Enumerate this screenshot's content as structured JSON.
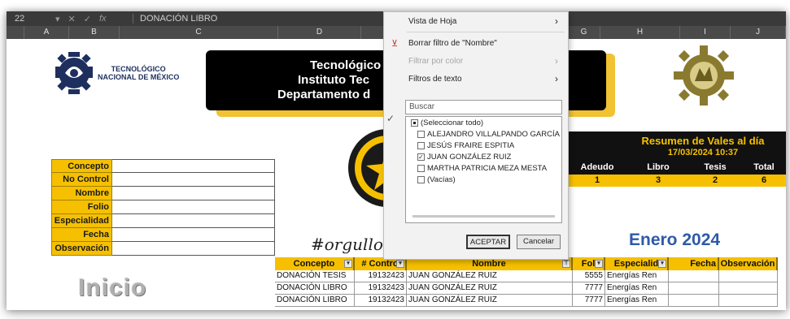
{
  "formula_bar": {
    "name_box": "22",
    "formula": "DONACIÓN LIBRO",
    "fx": "fx"
  },
  "columns": [
    "A",
    "B",
    "C",
    "D",
    "E",
    "F",
    "G",
    "H",
    "I",
    "J"
  ],
  "logo_tecnm": {
    "line1": "TECNOLÓGICO",
    "line2": "NACIONAL DE MÉXICO"
  },
  "banner": {
    "line1": "Tecnológico",
    "line2": "Instituto Tec",
    "line3": "Departamento d"
  },
  "form_labels": [
    "Concepto",
    "No Control",
    "Nombre",
    "Folio",
    "Especialidad",
    "Fecha",
    "Observación"
  ],
  "inicio": "Inicio",
  "orgullo": "#orgullo",
  "resumen": {
    "title": "Resumen de Vales al día",
    "date": "17/03/2024 10:37",
    "headers": [
      "Adeudo",
      "Libro",
      "Tesis",
      "Total"
    ],
    "values": [
      "1",
      "3",
      "2",
      "6"
    ]
  },
  "month_title": "Enero 2024",
  "table": {
    "headers": [
      "Concepto",
      "# Contro",
      "Nombre",
      "Fol",
      "Especialid",
      "Fecha",
      "Observación"
    ],
    "rows": [
      [
        "DONACIÓN TESIS",
        "19132423",
        "JUAN GONZÁLEZ RUIZ",
        "5555",
        "Energías Ren",
        "",
        ""
      ],
      [
        "DONACIÓN LIBRO",
        "19132423",
        "JUAN GONZÁLEZ RUIZ",
        "7777",
        "Energías Ren",
        "",
        ""
      ],
      [
        "DONACIÓN LIBRO",
        "19132423",
        "JUAN GONZÁLEZ RUIZ",
        "7777",
        "Energías Ren",
        "",
        ""
      ]
    ]
  },
  "filter_menu": {
    "vista_hoja": "Vista de Hoja",
    "borrar": "Borrar filtro de \"Nombre\"",
    "filtrar_color": "Filtrar por color",
    "filtros_texto": "Filtros de texto",
    "search_placeholder": "Buscar",
    "items": [
      {
        "label": "(Seleccionar todo)",
        "state": "partial"
      },
      {
        "label": "ALEJANDRO VILLALPANDO GARCÍA",
        "state": "unchecked"
      },
      {
        "label": "JESÚS FRAIRE ESPITIA",
        "state": "unchecked"
      },
      {
        "label": "JUAN GONZÁLEZ RUIZ",
        "state": "checked"
      },
      {
        "label": "MARTHA PATRICIA MEZA MESTA",
        "state": "unchecked"
      },
      {
        "label": "(Vacías)",
        "state": "unchecked"
      }
    ],
    "accept": "ACEPTAR",
    "cancel": "Cancelar"
  },
  "colors": {
    "gold": "#f6c000",
    "black": "#111111",
    "blue": "#2e5aa7"
  }
}
